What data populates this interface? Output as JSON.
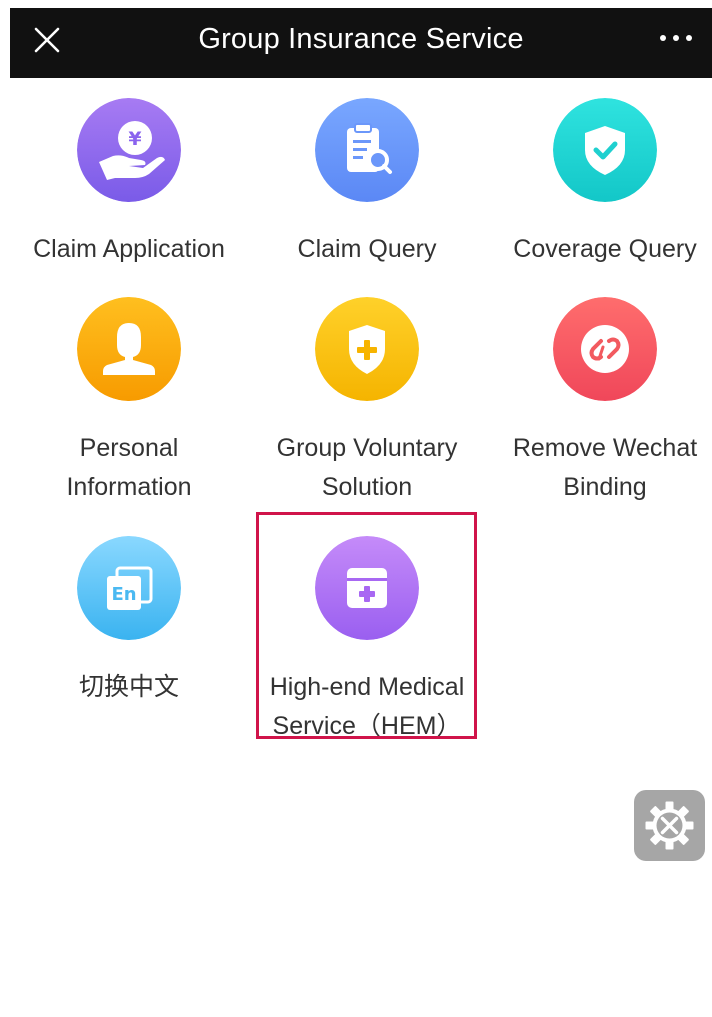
{
  "header": {
    "title": "Group Insurance Service",
    "close_icon": "close-icon",
    "more_icon": "more-icon"
  },
  "menu": [
    {
      "label_lines": [
        "Claim Application"
      ],
      "icon": "yen-hand-icon",
      "color_top": "#a77bf3",
      "color_bottom": "#7a5be8"
    },
    {
      "label_lines": [
        "Claim Query"
      ],
      "icon": "clipboard-search-icon",
      "color_top": "#79a7ff",
      "color_bottom": "#5b88f5"
    },
    {
      "label_lines": [
        "Coverage Query"
      ],
      "icon": "shield-check-icon",
      "color_top": "#2fe3df",
      "color_bottom": "#13c7c8"
    },
    {
      "label_lines": [
        "Personal",
        "Information"
      ],
      "icon": "person-icon",
      "color_top": "#ffbf1f",
      "color_bottom": "#f79b00"
    },
    {
      "label_lines": [
        "Group Voluntary",
        "Solution"
      ],
      "icon": "shield-plus-icon",
      "color_top": "#ffd12a",
      "color_bottom": "#f5b400"
    },
    {
      "label_lines": [
        "Remove Wechat",
        "Binding"
      ],
      "icon": "unlink-icon",
      "color_top": "#ff6d6d",
      "color_bottom": "#f0475a"
    },
    {
      "label_lines": [
        "切换中文"
      ],
      "icon": "language-en-icon",
      "color_top": "#8ad8ff",
      "color_bottom": "#3ab3f0"
    },
    {
      "label_lines": [
        "High-end Medical",
        "Service（HEM）"
      ],
      "icon": "medical-kit-icon",
      "color_top": "#c58bf9",
      "color_bottom": "#9a5ff0"
    }
  ],
  "tools_button_icon": "tools-gear-icon",
  "colors": {
    "header_bg": "#111111",
    "highlight": "#d0144a",
    "tools_bg": "#a6a6a6"
  }
}
